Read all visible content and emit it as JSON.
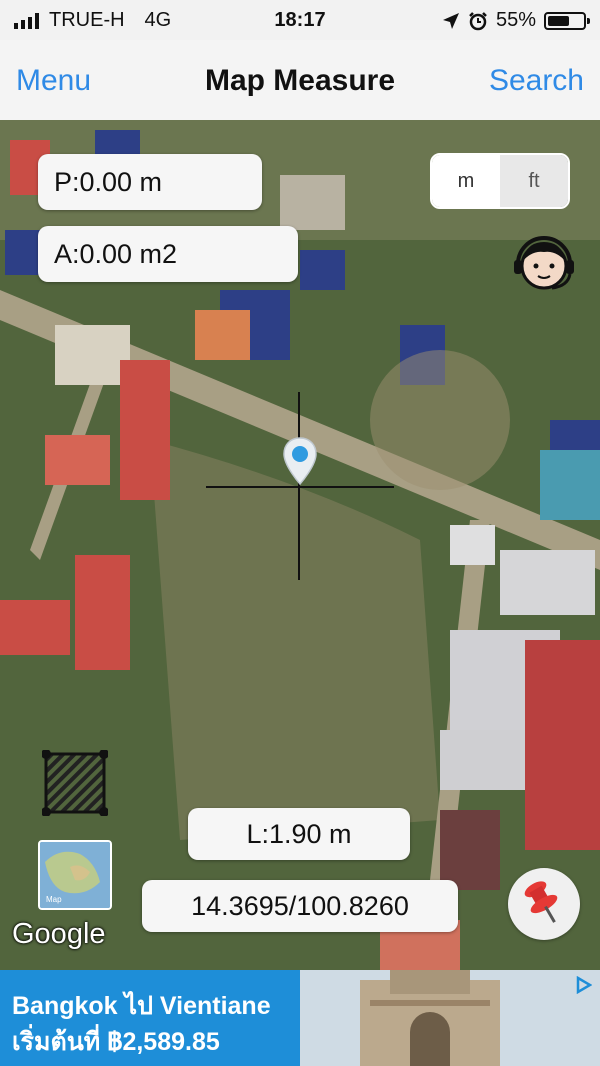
{
  "status_bar": {
    "carrier": "TRUE-H",
    "network": "4G",
    "time": "18:17",
    "battery": "55%",
    "battery_level": 0.55
  },
  "nav": {
    "menu_label": "Menu",
    "title": "Map Measure",
    "search_label": "Search"
  },
  "overlay": {
    "perimeter": "P:0.00 m",
    "area": "A:0.00 m2",
    "units": [
      "m",
      "ft"
    ],
    "length": "L:1.90 m",
    "coordinates": "14.3695/100.8260",
    "google_logo": "Google",
    "map_thumb_label": "Map"
  },
  "ad": {
    "line1": "Bangkok ไป Vientiane",
    "line2": "เริ่มต้นที่ ฿2,589.85"
  },
  "colors": {
    "accent": "#2f8ae6",
    "ad_background": "#1e8ed8",
    "pin_red": "#e53935"
  },
  "icons": [
    "signal-icon",
    "location-arrow-icon",
    "alarm-icon",
    "battery-icon",
    "support-agent-icon",
    "location-pin-icon",
    "area-draw-icon",
    "map-type-icon",
    "pushpin-icon",
    "ad-choices-icon"
  ]
}
